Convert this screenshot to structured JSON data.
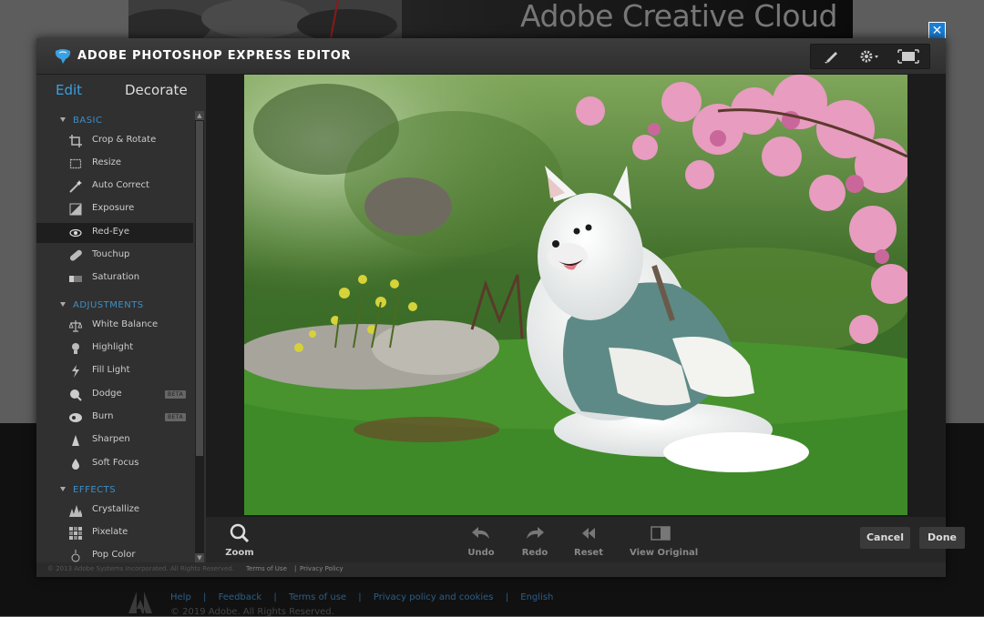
{
  "banner": {
    "title": "Adobe Creative Cloud"
  },
  "close_button": {
    "label": "✕"
  },
  "editor": {
    "title": "ADOBE PHOTOSHOP EXPRESS EDITOR",
    "toolbar_icons": [
      "brush-icon",
      "gear-icon",
      "fullscreen-icon"
    ]
  },
  "tabs": {
    "edit": "Edit",
    "decorate": "Decorate"
  },
  "sections": {
    "basic": "BASIC",
    "adjustments": "ADJUSTMENTS",
    "effects": "EFFECTS"
  },
  "tools": {
    "crop": "Crop & Rotate",
    "resize": "Resize",
    "auto_correct": "Auto Correct",
    "exposure": "Exposure",
    "red_eye": "Red-Eye",
    "touchup": "Touchup",
    "saturation": "Saturation",
    "white_balance": "White Balance",
    "highlight": "Highlight",
    "fill_light": "Fill Light",
    "dodge": "Dodge",
    "burn": "Burn",
    "sharpen": "Sharpen",
    "soft_focus": "Soft Focus",
    "crystallize": "Crystallize",
    "pixelate": "Pixelate",
    "pop_color": "Pop Color",
    "beta": "BETA",
    "selected": "Red-Eye"
  },
  "bottom": {
    "zoom": "Zoom",
    "undo": "Undo",
    "redo": "Redo",
    "reset": "Reset",
    "view_original": "View Original",
    "cancel": "Cancel",
    "done": "Done"
  },
  "editor_footer": {
    "copyright": "© 2013 Adobe Systems Incorporated. All Rights Reserved.",
    "terms": "Terms of Use",
    "separator": "|",
    "privacy": "Privacy Policy"
  },
  "page_footer": {
    "links": [
      "Help",
      "Feedback",
      "Terms of use",
      "Privacy policy and cookies",
      "English"
    ],
    "separator": "|",
    "copyright": "© 2019 Adobe. All Rights Reserved."
  },
  "colors": {
    "accent": "#3aa0e0",
    "close_bg": "#1a7fd6",
    "section": "#3e8fc7"
  }
}
